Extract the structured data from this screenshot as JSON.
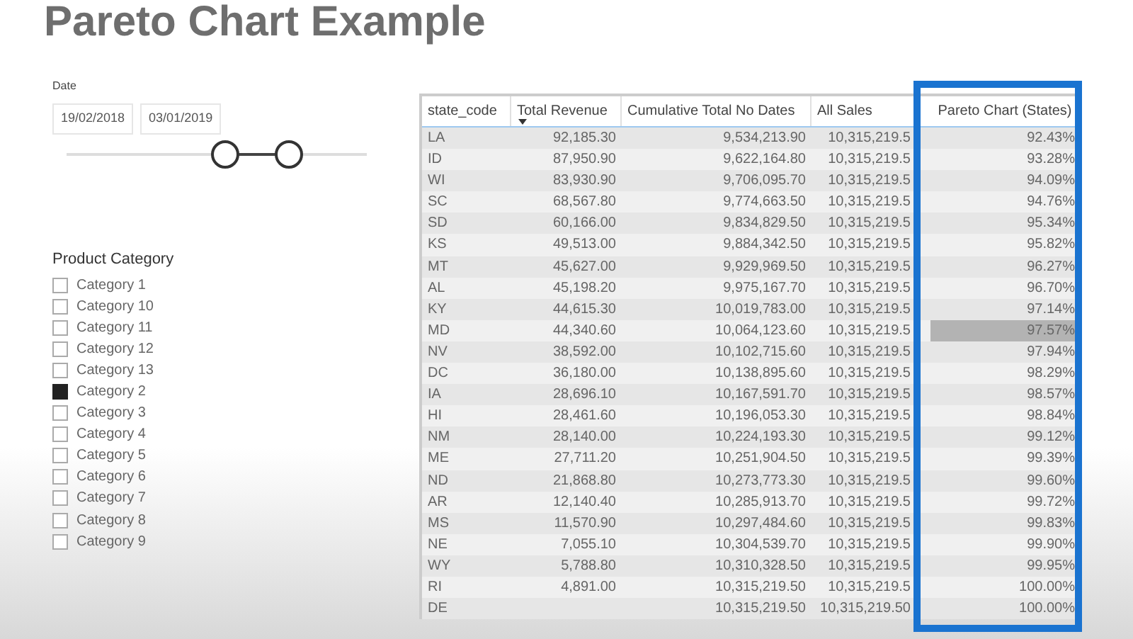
{
  "title": "Pareto Chart Example",
  "date_filter": {
    "label": "Date",
    "start": "19/02/2018",
    "end": "03/01/2019",
    "slider": {
      "start": {
        "level": 0.53
      },
      "end": {
        "level": 0.74
      }
    }
  },
  "category_filter": {
    "title": "Product Category",
    "items": [
      {
        "label": "Category 1",
        "checked": false
      },
      {
        "label": "Category 10",
        "checked": false
      },
      {
        "label": "Category 11",
        "checked": false
      },
      {
        "label": "Category 12",
        "checked": false
      },
      {
        "label": "Category 13",
        "checked": false
      },
      {
        "label": "Category 2",
        "checked": true
      },
      {
        "label": "Category 3",
        "checked": false
      },
      {
        "label": "Category 4",
        "checked": false
      },
      {
        "label": "Category 5",
        "checked": false
      },
      {
        "label": "Category 6",
        "checked": false
      },
      {
        "label": "Category 7",
        "checked": false
      },
      {
        "label": "Category 8",
        "checked": false
      },
      {
        "label": "Category 9",
        "checked": false
      }
    ]
  },
  "table": {
    "columns": [
      {
        "label": "state_code",
        "sorted": false
      },
      {
        "label": "Total Revenue",
        "sorted": true
      },
      {
        "label": "Cumulative Total No Dates",
        "sorted": false
      },
      {
        "label": "All Sales",
        "sorted": false
      },
      {
        "label": "Pareto Chart (States)",
        "sorted": false
      }
    ],
    "rows": [
      {
        "cells": [
          "LA",
          "92,185.30",
          "9,534,213.90",
          "10,315,219.5",
          "92.43%"
        ],
        "selected": false
      },
      {
        "cells": [
          "ID",
          "87,950.90",
          "9,622,164.80",
          "10,315,219.5",
          "93.28%"
        ],
        "selected": false
      },
      {
        "cells": [
          "WI",
          "83,930.90",
          "9,706,095.70",
          "10,315,219.5",
          "94.09%"
        ],
        "selected": false
      },
      {
        "cells": [
          "SC",
          "68,567.80",
          "9,774,663.50",
          "10,315,219.5",
          "94.76%"
        ],
        "selected": false
      },
      {
        "cells": [
          "SD",
          "60,166.00",
          "9,834,829.50",
          "10,315,219.5",
          "95.34%"
        ],
        "selected": false
      },
      {
        "cells": [
          "KS",
          "49,513.00",
          "9,884,342.50",
          "10,315,219.5",
          "95.82%"
        ],
        "selected": false
      },
      {
        "cells": [
          "MT",
          "45,627.00",
          "9,929,969.50",
          "10,315,219.5",
          "96.27%"
        ],
        "selected": false
      },
      {
        "cells": [
          "AL",
          "45,198.20",
          "9,975,167.70",
          "10,315,219.5",
          "96.70%"
        ],
        "selected": false
      },
      {
        "cells": [
          "KY",
          "44,615.30",
          "10,019,783.00",
          "10,315,219.5",
          "97.14%"
        ],
        "selected": false
      },
      {
        "cells": [
          "MD",
          "44,340.60",
          "10,064,123.60",
          "10,315,219.5",
          "97.57%"
        ],
        "selected": true
      },
      {
        "cells": [
          "NV",
          "38,592.00",
          "10,102,715.60",
          "10,315,219.5",
          "97.94%"
        ],
        "selected": false
      },
      {
        "cells": [
          "DC",
          "36,180.00",
          "10,138,895.60",
          "10,315,219.5",
          "98.29%"
        ],
        "selected": false
      },
      {
        "cells": [
          "IA",
          "28,696.10",
          "10,167,591.70",
          "10,315,219.5",
          "98.57%"
        ],
        "selected": false
      },
      {
        "cells": [
          "HI",
          "28,461.60",
          "10,196,053.30",
          "10,315,219.5",
          "98.84%"
        ],
        "selected": false
      },
      {
        "cells": [
          "NM",
          "28,140.00",
          "10,224,193.30",
          "10,315,219.5",
          "99.12%"
        ],
        "selected": false
      },
      {
        "cells": [
          "ME",
          "27,711.20",
          "10,251,904.50",
          "10,315,219.5",
          "99.39%"
        ],
        "selected": false
      },
      {
        "cells": [
          "ND",
          "21,868.80",
          "10,273,773.30",
          "10,315,219.5",
          "99.60%"
        ],
        "selected": false
      },
      {
        "cells": [
          "AR",
          "12,140.40",
          "10,285,913.70",
          "10,315,219.5",
          "99.72%"
        ],
        "selected": false
      },
      {
        "cells": [
          "MS",
          "11,570.90",
          "10,297,484.60",
          "10,315,219.5",
          "99.83%"
        ],
        "selected": false
      },
      {
        "cells": [
          "NE",
          "7,055.10",
          "10,304,539.70",
          "10,315,219.5",
          "99.90%"
        ],
        "selected": false
      },
      {
        "cells": [
          "WY",
          "5,788.80",
          "10,310,328.50",
          "10,315,219.5",
          "99.95%"
        ],
        "selected": false
      },
      {
        "cells": [
          "RI",
          "4,891.00",
          "10,315,219.50",
          "10,315,219.5",
          "100.00%"
        ],
        "selected": false
      },
      {
        "cells": [
          "DE",
          "",
          "10,315,219.50",
          "10,315,219.50",
          "100.00%"
        ],
        "selected": false
      }
    ]
  }
}
